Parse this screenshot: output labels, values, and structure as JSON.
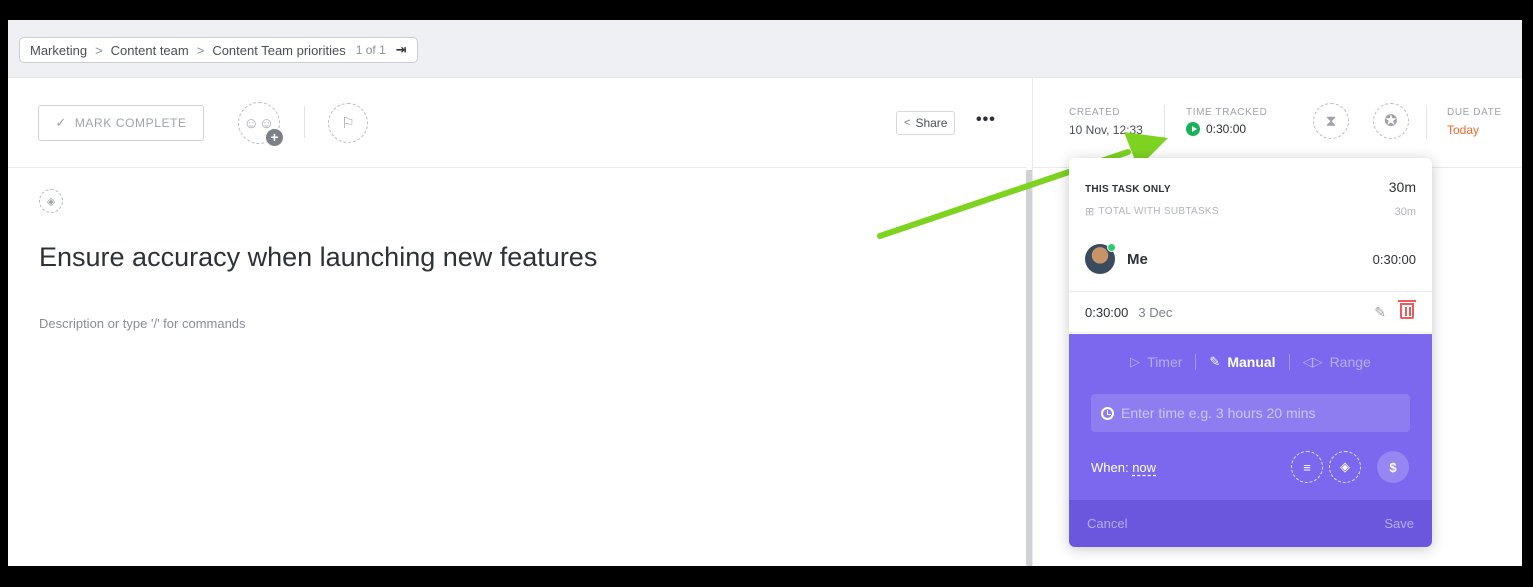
{
  "breadcrumb": {
    "items": [
      "Marketing",
      "Content team",
      "Content Team priorities"
    ],
    "separator": ">",
    "count": "1 of 1"
  },
  "toolbar": {
    "mark_complete": "MARK COMPLETE",
    "share": "Share",
    "more": "•••"
  },
  "task": {
    "title": "Ensure accuracy when launching new features",
    "description_placeholder": "Description or type '/' for commands"
  },
  "meta": {
    "created_label": "CREATED",
    "created_value": "10 Nov, 12:33",
    "time_tracked_label": "TIME TRACKED",
    "time_tracked_value": "0:30:00",
    "due_label": "DUE DATE",
    "due_value": "Today"
  },
  "popup": {
    "this_task_label": "THIS TASK ONLY",
    "this_task_value": "30m",
    "total_label": "TOTAL WITH SUBTASKS",
    "total_value": "30m",
    "user_name": "Me",
    "user_total": "0:30:00",
    "entry_time": "0:30:00",
    "entry_date": "3 Dec",
    "modes": [
      "Timer",
      "Manual",
      "Range"
    ],
    "active_mode": "Manual",
    "input_placeholder": "Enter time e.g. 3 hours 20 mins",
    "when_label": "When:",
    "when_value": "now",
    "billable_symbol": "$",
    "cancel": "Cancel",
    "save": "Save"
  },
  "colors": {
    "accent_purple": "#7b68ee",
    "tracked_green": "#18b159",
    "due_orange": "#f06a2c",
    "arrow_green": "#7ed321",
    "delete_red": "#ef5a5a"
  },
  "icons": [
    "check-icon",
    "assignee-add-icon",
    "flag-icon",
    "share-icon",
    "tag-icon",
    "play-icon",
    "hourglass-icon",
    "points-icon",
    "subtasks-icon",
    "pencil-icon",
    "trash-icon",
    "timer-icon",
    "manual-edit-icon",
    "range-icon",
    "clock-icon",
    "notes-icon",
    "tag-icon",
    "billable-icon",
    "exit-icon"
  ]
}
